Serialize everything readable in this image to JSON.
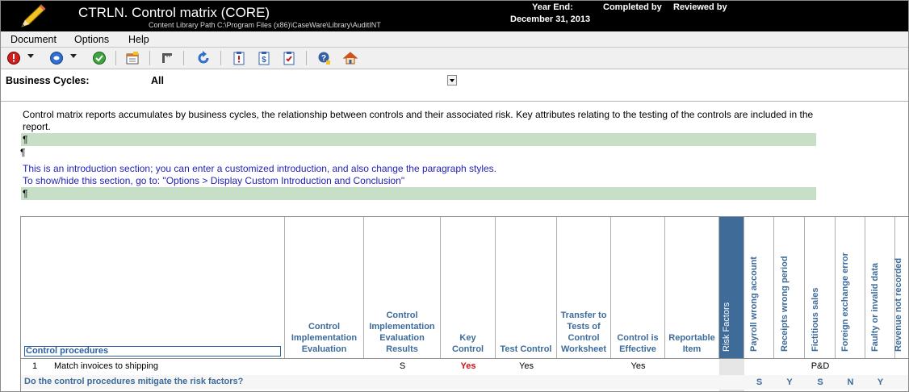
{
  "title_bar": {
    "title": "CTRLN. Control matrix (CORE)",
    "library_path": "Content Library Path  C:\\Program Files (x86)\\CaseWare\\Library\\AuditINT",
    "year_end_label": "Year End:",
    "year_end_value": "December 31, 2013",
    "completed_by_label": "Completed by",
    "reviewed_by_label": "Reviewed by"
  },
  "menu": [
    "Document",
    "Options",
    "Help"
  ],
  "toolbar_icons": [
    "stop-icon",
    "circle-arrow-icon",
    "check-icon",
    "calendar-icon",
    "ruler-icon",
    "refresh-icon",
    "clipboard-icon",
    "dollar-icon",
    "checklist-icon",
    "help-icon",
    "home-icon"
  ],
  "filter": {
    "label": "Business Cycles:",
    "value": "All"
  },
  "intro": {
    "text": "Control matrix reports accumulates by business cycles, the relationship between controls and their associated risk.  Key attributes relating to the testing of the controls are included in the report.",
    "pilcrow": "¶",
    "custom_line1": "This is an introduction section; you can enter a customized introduction, and also change the paragraph styles.",
    "custom_line2": "To show/hide this section, go to: \"Options > Display Custom Introduction and Conclusion\""
  },
  "matrix": {
    "procedures_header": "Control procedures",
    "columns": [
      "Control Implementation Evaluation",
      "Control Implementation Evaluation Results",
      "Key Control",
      "Test Control",
      "Transfer to Tests of Control Worksheet",
      "Control is Effective",
      "Reportable Item"
    ],
    "risk_factors_label": "Risk Factors",
    "risk_columns": [
      "Payroll wrong account",
      "Receipts wrong period",
      "Fictitious sales",
      "Foreign exchange error",
      "Faulty or invalid data",
      "Revenue not recorded"
    ],
    "row1": {
      "num": "1",
      "procedure": "Match invoices to shipping",
      "eval_result": "S",
      "key_control": "Yes",
      "test_control": "Yes",
      "effective": "Yes",
      "risk_value": "P&D"
    },
    "question": "Do the control procedures mitigate the risk factors?",
    "answers": [
      "S",
      "Y",
      "S",
      "N",
      "Y"
    ]
  },
  "colors": {
    "header_blue": "#3d6b9a",
    "risk_bg": "#3e6b98",
    "green_para": "#c6dfc6",
    "intro_blue": "#1f1fb8",
    "key_red": "#d01010"
  }
}
